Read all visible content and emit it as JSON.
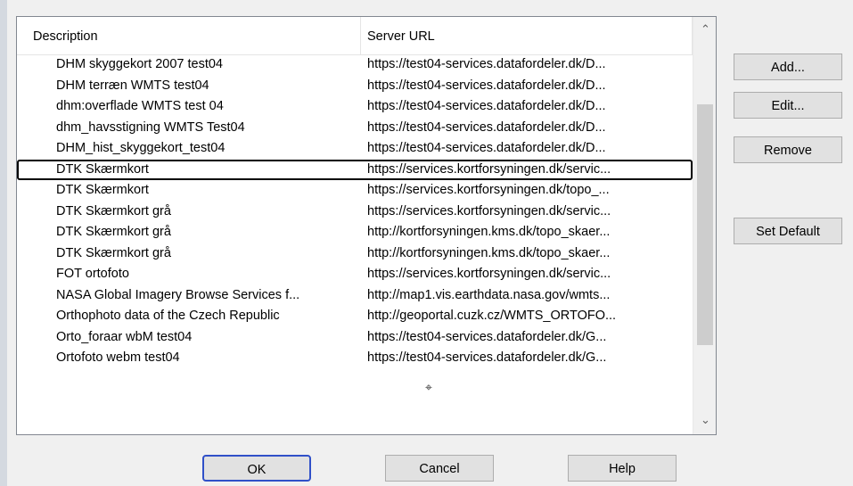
{
  "table": {
    "columns": [
      "Description",
      "Server URL"
    ],
    "rows": [
      {
        "description": "DHM skyggekort 2007 test04",
        "url": "https://test04-services.datafordeler.dk/D..."
      },
      {
        "description": "DHM terræn WMTS test04",
        "url": "https://test04-services.datafordeler.dk/D..."
      },
      {
        "description": "dhm:overflade WMTS test 04",
        "url": "https://test04-services.datafordeler.dk/D..."
      },
      {
        "description": "dhm_havsstigning WMTS Test04",
        "url": "https://test04-services.datafordeler.dk/D..."
      },
      {
        "description": "DHM_hist_skyggekort_test04",
        "url": "https://test04-services.datafordeler.dk/D..."
      },
      {
        "description": "DTK Skærmkort",
        "url": "https://services.kortforsyningen.dk/servic..."
      },
      {
        "description": "DTK Skærmkort",
        "url": "https://services.kortforsyningen.dk/topo_..."
      },
      {
        "description": "DTK Skærmkort grå",
        "url": "https://services.kortforsyningen.dk/servic..."
      },
      {
        "description": "DTK Skærmkort grå",
        "url": "http://kortforsyningen.kms.dk/topo_skaer..."
      },
      {
        "description": "DTK Skærmkort grå",
        "url": "http://kortforsyningen.kms.dk/topo_skaer..."
      },
      {
        "description": "FOT ortofoto",
        "url": "https://services.kortforsyningen.dk/servic..."
      },
      {
        "description": "NASA Global Imagery Browse Services f...",
        "url": "http://map1.vis.earthdata.nasa.gov/wmts..."
      },
      {
        "description": "Orthophoto data of the Czech Republic",
        "url": "http://geoportal.cuzk.cz/WMTS_ORTOFO..."
      },
      {
        "description": "Orto_foraar wbM test04",
        "url": "https://test04-services.datafordeler.dk/G..."
      },
      {
        "description": "Ortofoto webm test04",
        "url": "https://test04-services.datafordeler.dk/G..."
      }
    ],
    "highlighted_row": 5
  },
  "buttons": {
    "add": "Add...",
    "edit": "Edit...",
    "remove": "Remove",
    "set_default": "Set Default",
    "ok": "OK",
    "cancel": "Cancel",
    "help": "Help"
  },
  "scrollbar": {
    "up_icon": "▲",
    "down_icon": "▼"
  }
}
